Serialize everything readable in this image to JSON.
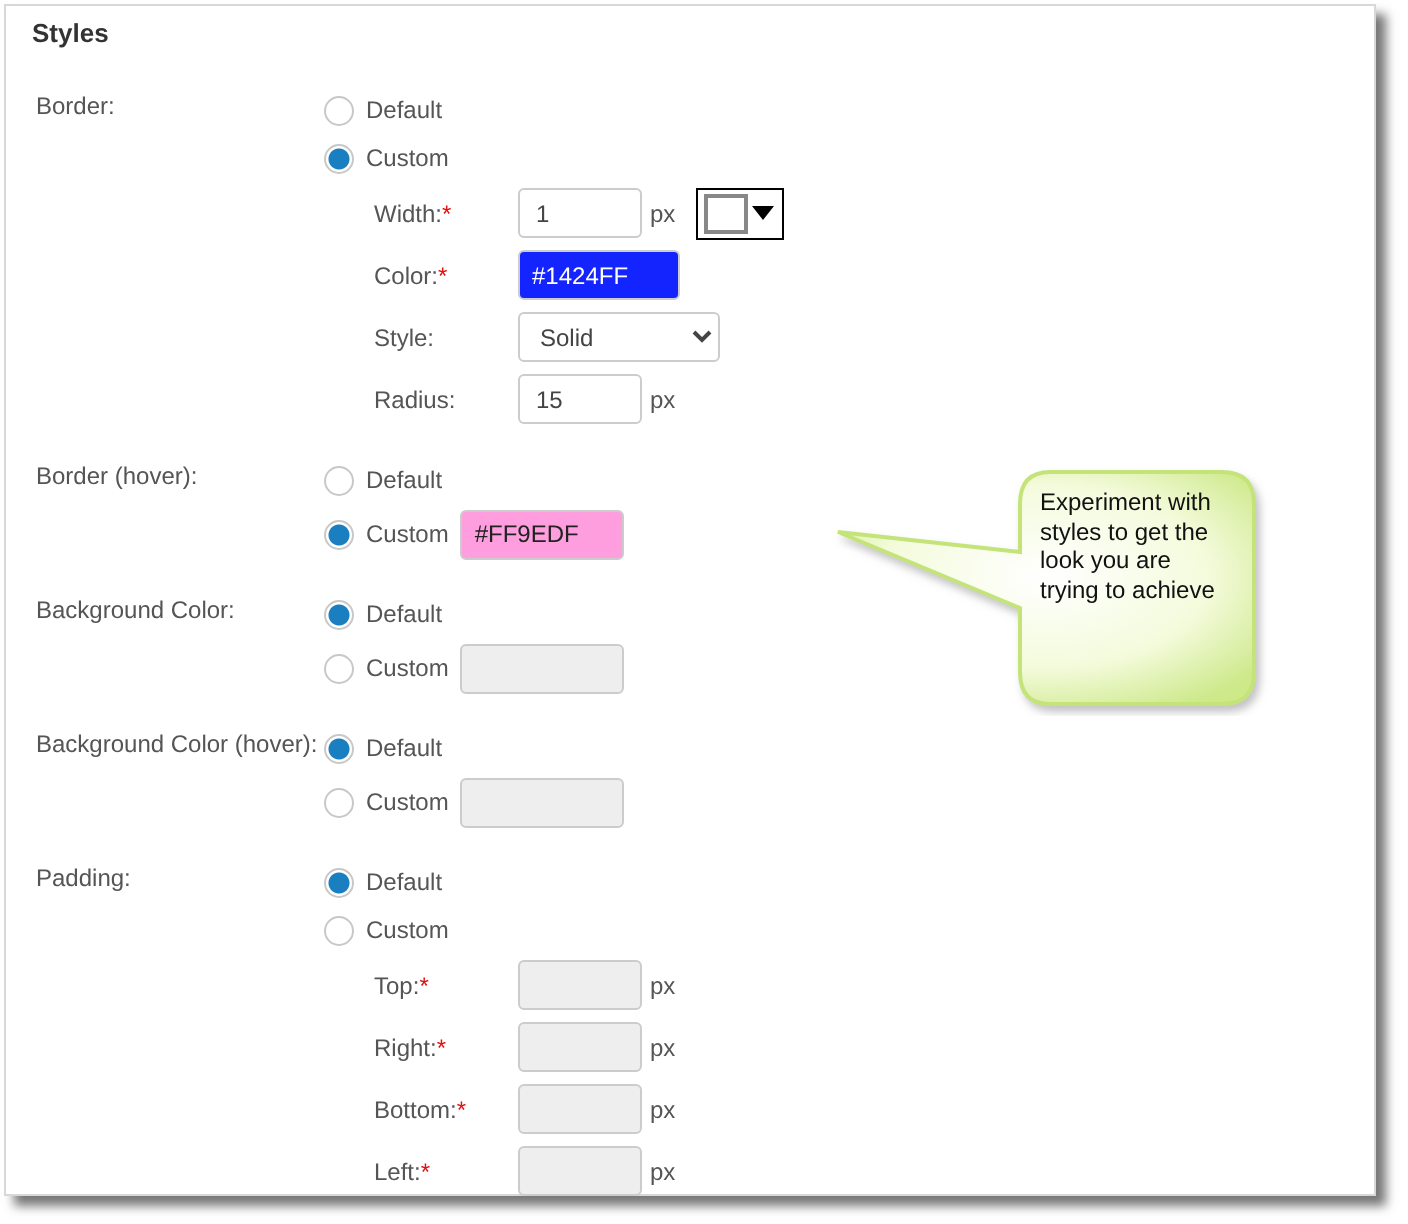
{
  "section_title": "Styles",
  "groups": [
    {
      "label": "Border:",
      "options": [
        {
          "label": "Default",
          "selected": false
        },
        {
          "label": "Custom",
          "selected": true
        }
      ],
      "fields": [
        {
          "kind": "input",
          "label": "Width:",
          "required_mark": "*",
          "value": "1",
          "unit": "px",
          "picker": true
        },
        {
          "kind": "color",
          "label": "Color:",
          "required_mark": "*",
          "value": "#1424FF",
          "color": "#1424ff"
        },
        {
          "kind": "select",
          "label": "Style:",
          "value": "Solid"
        },
        {
          "kind": "input",
          "label": "Radius:",
          "value": "15",
          "unit": "px"
        }
      ]
    },
    {
      "label": "Border (hover):",
      "options": [
        {
          "label": "Default",
          "selected": false
        },
        {
          "label": "Custom",
          "selected": true,
          "field": {
            "value": "#FF9EDF",
            "color": "#ff9edf",
            "disabled": false
          }
        }
      ]
    },
    {
      "label": "Background Color:",
      "options": [
        {
          "label": "Default",
          "selected": true
        },
        {
          "label": "Custom",
          "selected": false,
          "field": {
            "disabled": true
          }
        }
      ]
    },
    {
      "label": "Background Color (hover):",
      "options": [
        {
          "label": "Default",
          "selected": true
        },
        {
          "label": "Custom",
          "selected": false,
          "field": {
            "disabled": true
          }
        }
      ]
    },
    {
      "label": "Padding:",
      "options": [
        {
          "label": "Default",
          "selected": true
        },
        {
          "label": "Custom",
          "selected": false
        }
      ],
      "fields": [
        {
          "kind": "input",
          "label": "Top:",
          "required_mark": "*",
          "unit": "px",
          "disabled": true
        },
        {
          "kind": "input",
          "label": "Right:",
          "required_mark": "*",
          "unit": "px",
          "disabled": true
        },
        {
          "kind": "input",
          "label": "Bottom:",
          "required_mark": "*",
          "unit": "px",
          "disabled": true
        },
        {
          "kind": "input",
          "label": "Left:",
          "required_mark": "*",
          "unit": "px",
          "disabled": true
        }
      ]
    }
  ],
  "callout": {
    "text": "Experiment with styles to get the look you are trying to achieve"
  }
}
